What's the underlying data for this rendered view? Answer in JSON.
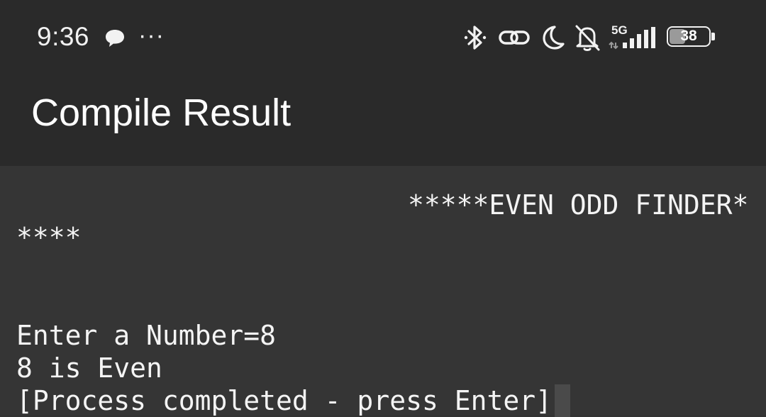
{
  "status_bar": {
    "time": "9:36",
    "overflow_dots": "···",
    "network_type": "5G",
    "battery_level": "38",
    "icons": [
      "chat-bubble-icon",
      "bluetooth-icon",
      "link-icon",
      "moon-icon",
      "bell-off-icon",
      "signal-icon",
      "battery-icon"
    ]
  },
  "app_bar": {
    "title": "Compile Result"
  },
  "terminal": {
    "header_line1": "*****EVEN ODD FINDER*",
    "header_line2": "****",
    "prompt_line": "Enter a Number=8",
    "result_line": "8 is Even",
    "completion_line": "[Process completed - press Enter]"
  },
  "colors": {
    "topbar_bg": "#2a2a2a",
    "terminal_bg": "#353535",
    "text": "#f4f4f4"
  }
}
